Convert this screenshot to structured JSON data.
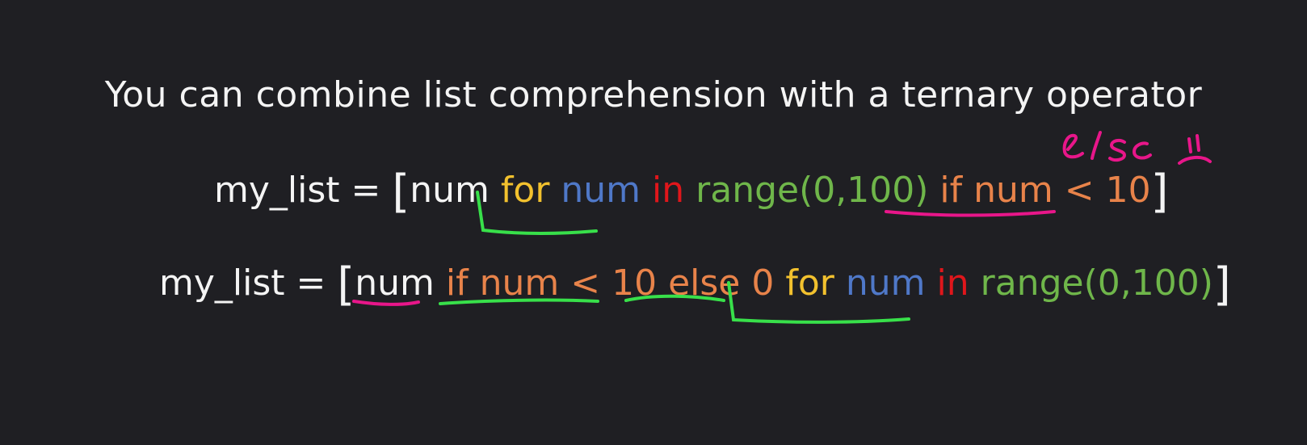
{
  "title": "You can combine list comprehension with a ternary operator",
  "colors": {
    "background": "#1f1f23",
    "white": "#f4f4f4",
    "keyword_for": "#f2c12e",
    "variable": "#4f78c8",
    "keyword_in": "#e0161b",
    "range": "#6fb64a",
    "condition": "#e8834a",
    "annotation_pink": "#e8168a",
    "annotation_green": "#38e04a"
  },
  "line1": {
    "target": "my_list",
    "equals": "=",
    "open_bracket": "[",
    "expr": "num",
    "for_kw": "for",
    "loop_var": "num",
    "in_kw": "in",
    "iterable": "range(0,100)",
    "condition": "if num < 10",
    "close_bracket": "]"
  },
  "line2": {
    "target": "my_list",
    "equals": "=",
    "open_bracket": "[",
    "expr": "num",
    "if_cond": "if num < 10",
    "else_part": "else 0",
    "for_kw": "for",
    "loop_var": "num",
    "in_kw": "in",
    "iterable": "range(0,100)",
    "close_bracket": "]"
  },
  "handwritten_note": "else !!"
}
